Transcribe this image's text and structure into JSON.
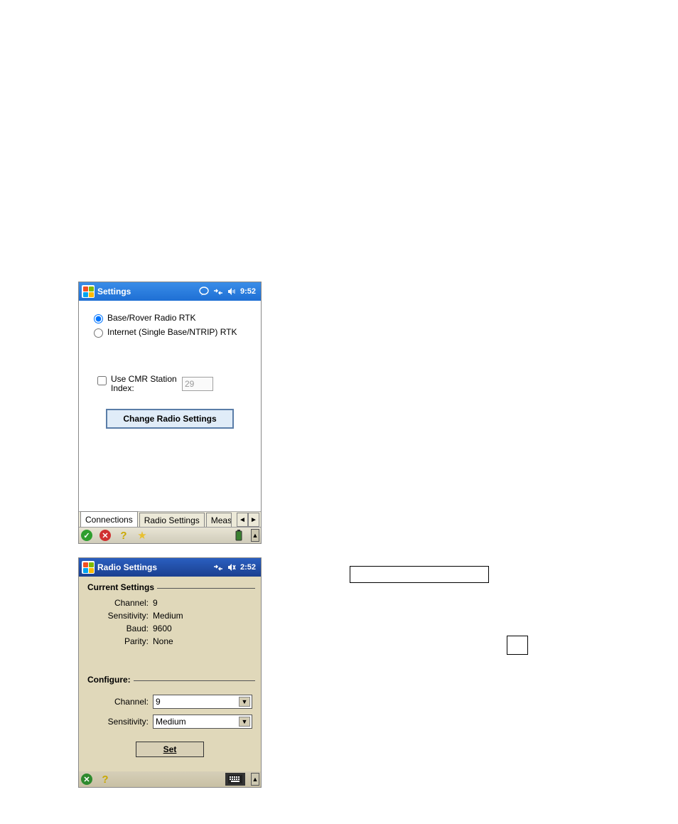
{
  "device1": {
    "title": "Settings",
    "time": "9:52",
    "radios": {
      "option1": "Base/Rover Radio RTK",
      "option2": "Internet (Single Base/NTRIP) RTK"
    },
    "cmr": {
      "label": "Use CMR Station Index:",
      "value": "29"
    },
    "changeBtn": "Change Radio Settings",
    "tabs": {
      "t1": "Connections",
      "t2": "Radio Settings",
      "t3": "Meas"
    }
  },
  "device2": {
    "title": "Radio Settings",
    "time": "2:52",
    "current": {
      "legend": "Current Settings",
      "channel_label": "Channel:",
      "channel": "9",
      "sensitivity_label": "Sensitivity:",
      "sensitivity": "Medium",
      "baud_label": "Baud:",
      "baud": "9600",
      "parity_label": "Parity:",
      "parity": "None"
    },
    "configure": {
      "legend": "Configure:",
      "channel_label": "Channel:",
      "channel": "9",
      "sensitivity_label": "Sensitivity:",
      "sensitivity": "Medium",
      "setBtn": "Set"
    }
  }
}
